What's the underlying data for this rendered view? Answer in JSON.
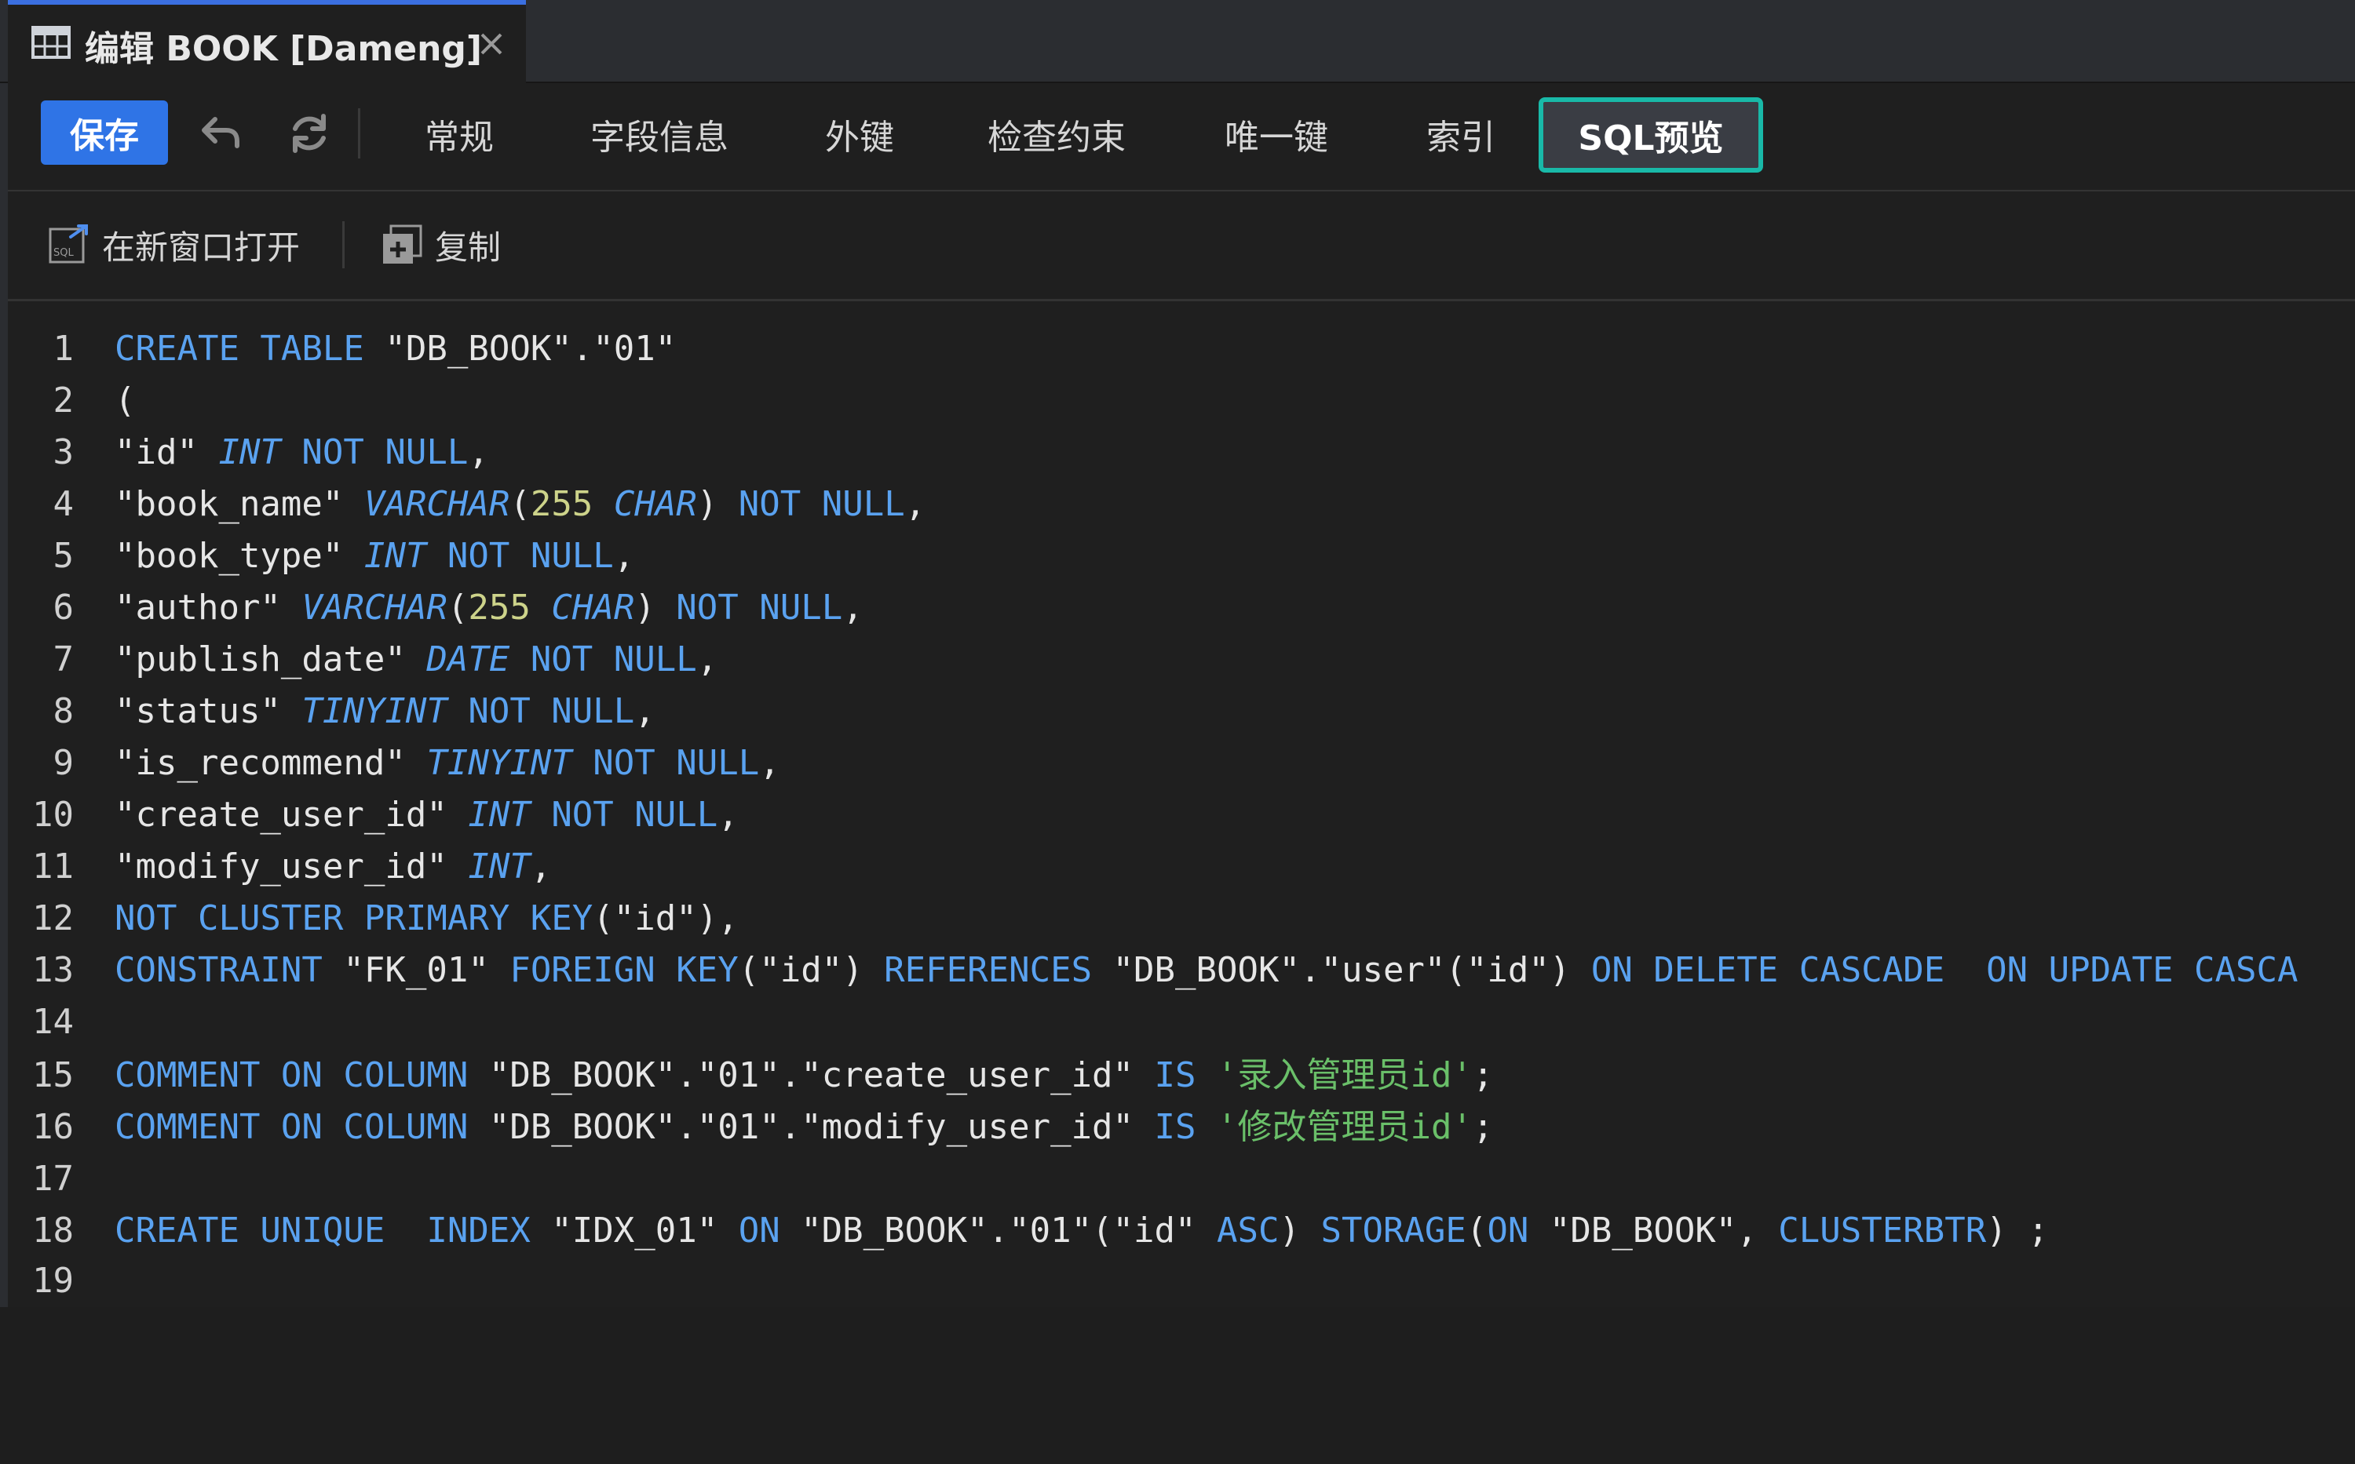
{
  "tab": {
    "title": "编辑 BOOK [Dameng]",
    "icon": "table-grid-icon",
    "close_icon": "close-icon"
  },
  "toolbar": {
    "save_label": "保存",
    "undo_icon": "undo-icon",
    "refresh_icon": "refresh-icon",
    "tabs": [
      {
        "label": "常规",
        "active": false
      },
      {
        "label": "字段信息",
        "active": false
      },
      {
        "label": "外键",
        "active": false
      },
      {
        "label": "检查约束",
        "active": false
      },
      {
        "label": "唯一键",
        "active": false
      },
      {
        "label": "索引",
        "active": false
      },
      {
        "label": "SQL预览",
        "active": true
      }
    ]
  },
  "subtoolbar": {
    "open_new_window_label": "在新窗口打开",
    "copy_label": "复制"
  },
  "colors": {
    "accent": "#2f74e6",
    "active_tab_border": "#19b9a8",
    "keyword": "#5aa2f0",
    "number": "#cdd38a",
    "string": "#6abf69"
  },
  "code_lines": [
    {
      "n": "1",
      "tokens": [
        [
          "kw",
          "CREATE TABLE"
        ],
        [
          "pl",
          " \"DB_BOOK\".\"01\""
        ]
      ]
    },
    {
      "n": "2",
      "tokens": [
        [
          "pl",
          "("
        ]
      ]
    },
    {
      "n": "3",
      "tokens": [
        [
          "pl",
          "\"id\" "
        ],
        [
          "ty",
          "INT"
        ],
        [
          "kw",
          " NOT NULL"
        ],
        [
          "pl",
          ","
        ]
      ]
    },
    {
      "n": "4",
      "tokens": [
        [
          "pl",
          "\"book_name\" "
        ],
        [
          "ty",
          "VARCHAR"
        ],
        [
          "pl",
          "("
        ],
        [
          "num",
          "255"
        ],
        [
          "pl",
          " "
        ],
        [
          "ty",
          "CHAR"
        ],
        [
          "pl",
          ")"
        ],
        [
          "kw",
          " NOT NULL"
        ],
        [
          "pl",
          ","
        ]
      ]
    },
    {
      "n": "5",
      "tokens": [
        [
          "pl",
          "\"book_type\" "
        ],
        [
          "ty",
          "INT"
        ],
        [
          "kw",
          " NOT NULL"
        ],
        [
          "pl",
          ","
        ]
      ]
    },
    {
      "n": "6",
      "tokens": [
        [
          "pl",
          "\"author\" "
        ],
        [
          "ty",
          "VARCHAR"
        ],
        [
          "pl",
          "("
        ],
        [
          "num",
          "255"
        ],
        [
          "pl",
          " "
        ],
        [
          "ty",
          "CHAR"
        ],
        [
          "pl",
          ")"
        ],
        [
          "kw",
          " NOT NULL"
        ],
        [
          "pl",
          ","
        ]
      ]
    },
    {
      "n": "7",
      "tokens": [
        [
          "pl",
          "\"publish_date\" "
        ],
        [
          "ty",
          "DATE"
        ],
        [
          "kw",
          " NOT NULL"
        ],
        [
          "pl",
          ","
        ]
      ]
    },
    {
      "n": "8",
      "tokens": [
        [
          "pl",
          "\"status\" "
        ],
        [
          "ty",
          "TINYINT"
        ],
        [
          "kw",
          " NOT NULL"
        ],
        [
          "pl",
          ","
        ]
      ]
    },
    {
      "n": "9",
      "tokens": [
        [
          "pl",
          "\"is_recommend\" "
        ],
        [
          "ty",
          "TINYINT"
        ],
        [
          "kw",
          " NOT NULL"
        ],
        [
          "pl",
          ","
        ]
      ]
    },
    {
      "n": "10",
      "tokens": [
        [
          "pl",
          "\"create_user_id\" "
        ],
        [
          "ty",
          "INT"
        ],
        [
          "kw",
          " NOT NULL"
        ],
        [
          "pl",
          ","
        ]
      ]
    },
    {
      "n": "11",
      "tokens": [
        [
          "pl",
          "\"modify_user_id\" "
        ],
        [
          "ty",
          "INT"
        ],
        [
          "pl",
          ","
        ]
      ]
    },
    {
      "n": "12",
      "tokens": [
        [
          "kw",
          "NOT CLUSTER PRIMARY KEY"
        ],
        [
          "pl",
          "(\"id\"),"
        ]
      ]
    },
    {
      "n": "13",
      "tokens": [
        [
          "kw",
          "CONSTRAINT"
        ],
        [
          "pl",
          " \"FK_01\" "
        ],
        [
          "kw",
          "FOREIGN KEY"
        ],
        [
          "pl",
          "(\"id\") "
        ],
        [
          "kw",
          "REFERENCES"
        ],
        [
          "pl",
          " \"DB_BOOK\".\"user\"(\"id\") "
        ],
        [
          "kw",
          "ON DELETE CASCADE  ON UPDATE CASCA"
        ]
      ]
    },
    {
      "n": "14",
      "tokens": []
    },
    {
      "n": "15",
      "tokens": [
        [
          "kw",
          "COMMENT ON COLUMN"
        ],
        [
          "pl",
          " \"DB_BOOK\".\"01\".\"create_user_id\" "
        ],
        [
          "kw",
          "IS"
        ],
        [
          "pl",
          " "
        ],
        [
          "str",
          "'录入管理员id'"
        ],
        [
          "pl",
          ";"
        ]
      ]
    },
    {
      "n": "16",
      "tokens": [
        [
          "kw",
          "COMMENT ON COLUMN"
        ],
        [
          "pl",
          " \"DB_BOOK\".\"01\".\"modify_user_id\" "
        ],
        [
          "kw",
          "IS"
        ],
        [
          "pl",
          " "
        ],
        [
          "str",
          "'修改管理员id'"
        ],
        [
          "pl",
          ";"
        ]
      ]
    },
    {
      "n": "17",
      "tokens": []
    },
    {
      "n": "18",
      "tokens": [
        [
          "kw",
          "CREATE UNIQUE  INDEX"
        ],
        [
          "pl",
          " \"IDX_01\" "
        ],
        [
          "kw",
          "ON"
        ],
        [
          "pl",
          " \"DB_BOOK\".\"01\"(\"id\" "
        ],
        [
          "kw",
          "ASC"
        ],
        [
          "pl",
          ") "
        ],
        [
          "kw",
          "STORAGE"
        ],
        [
          "pl",
          "("
        ],
        [
          "kw",
          "ON"
        ],
        [
          "pl",
          " \"DB_BOOK\", "
        ],
        [
          "kw",
          "CLUSTERBTR"
        ],
        [
          "pl",
          ") ;"
        ]
      ]
    },
    {
      "n": "19",
      "tokens": []
    }
  ]
}
